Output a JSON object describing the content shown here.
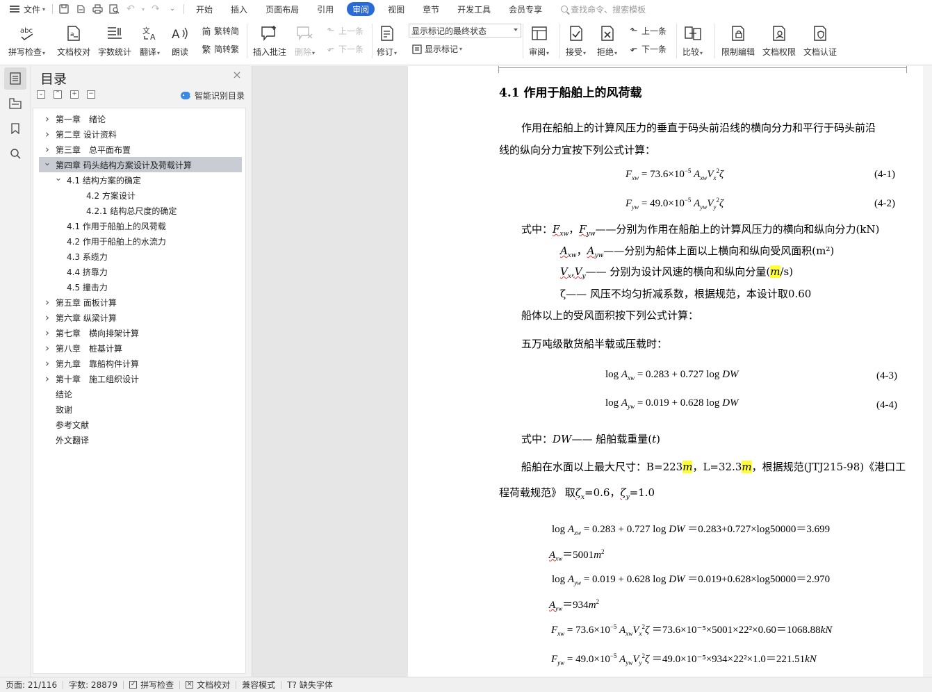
{
  "menubar": {
    "file_label": "文件",
    "tabs": [
      "开始",
      "插入",
      "页面布局",
      "引用",
      "审阅",
      "视图",
      "章节",
      "开发工具",
      "会员专享"
    ],
    "active_tab": "审阅",
    "search_placeholder": "查找命令、搜索模板"
  },
  "ribbon": {
    "spell_check": "拼写检查",
    "doc_proof": "文档校对",
    "word_count": "字数统计",
    "translate": "翻译",
    "read_aloud": "朗读",
    "to_traditional": "繁转简",
    "to_simplified": "简转繁",
    "insert_comment": "插入批注",
    "delete": "删除",
    "prev_comment": "上一条",
    "next_comment": "下一条",
    "track_changes": "修订",
    "markup_mode": "显示标记的最终状态",
    "show_markup": "显示标记",
    "review_pane": "审阅",
    "accept": "接受",
    "reject": "拒绝",
    "prev_change": "上一条",
    "next_change": "下一条",
    "compare": "比较",
    "restrict_edit": "限制编辑",
    "doc_permission": "文档权限",
    "doc_cert": "文档认证"
  },
  "toc": {
    "title": "目录",
    "smart_label": "智能识别目录",
    "items": [
      {
        "label": "第一章　绪论",
        "level": 0,
        "expand": "right"
      },
      {
        "label": "第二章  设计资料",
        "level": 0,
        "expand": "right"
      },
      {
        "label": "第三章　总平面布置",
        "level": 0,
        "expand": "right"
      },
      {
        "label": "第四章  码头结构方案设计及荷载计算",
        "level": 0,
        "expand": "down",
        "selected": true
      },
      {
        "label": "4.1  结构方案的确定",
        "level": 1,
        "expand": "down"
      },
      {
        "label": "4.2 方案设计",
        "level": 2
      },
      {
        "label": "4.2.1 结构总尺度的确定",
        "level": 2
      },
      {
        "label": "4.1 作用于船舶上的风荷载",
        "level": 1
      },
      {
        "label": "4.2 作用于船舶上的水流力",
        "level": 1
      },
      {
        "label": "4.3 系缆力",
        "level": 1
      },
      {
        "label": "4.4 挤靠力",
        "level": 1
      },
      {
        "label": "4.5 撞击力",
        "level": 1
      },
      {
        "label": "第五章  面板计算",
        "level": 0,
        "expand": "right"
      },
      {
        "label": "第六章  纵梁计算",
        "level": 0,
        "expand": "right"
      },
      {
        "label": "第七章　横向排架计算",
        "level": 0,
        "expand": "right"
      },
      {
        "label": "第八章　桩基计算",
        "level": 0,
        "expand": "right"
      },
      {
        "label": "第九章　靠船构件计算",
        "level": 0,
        "expand": "right"
      },
      {
        "label": "第十章　施工组织设计",
        "level": 0,
        "expand": "right"
      },
      {
        "label": "结论",
        "level": 0
      },
      {
        "label": "致谢",
        "level": 0
      },
      {
        "label": "参考文献",
        "level": 0
      },
      {
        "label": "外文翻译",
        "level": 0
      }
    ]
  },
  "doc": {
    "heading": "4.1 作用于船舶上的风荷载",
    "para1a": "作用在船舶上的计算风压力的垂直于码头前沿线的横向分力和平行于码头前沿",
    "para1b": "线的纵向分力宜按下列公式计算：",
    "eqno1": "(4-1)",
    "eqno2": "(4-2)",
    "where1_prefix": "式中：",
    "where1_text": "——分别为作用在船舶上的计算风压力的横向和纵向分力(kN)",
    "where2_text": "——分别为船体上面以上横向和纵向受风面积(m²)",
    "where3_text": "——  分别为设计风速的横向和纵向分量(",
    "where3_unit_m": "m",
    "where3_unit_rest": "/s)",
    "where4_text": "ζ——  风压不均匀折减系数，根据规范，本设计取0.60",
    "para2": "船体以上的受风面积按下列公式计算：",
    "para3": "五万吨级散货船半载或压载时：",
    "eqno3": "(4-3)",
    "eqno4": "(4-4)",
    "where5_prefix": "式中：",
    "where5_text": "——  船舶载重量(",
    "where5_unit": "t",
    "para4a_1": "船舶在水面以上最大尺寸：B=223",
    "para4a_m1": "m",
    "para4a_2": "，L=32.3",
    "para4a_m2": "m",
    "para4a_3": "，根据规范(JTJ215-98)《港口工",
    "para4b": "程荷载规范》 取",
    "calc1_rhs": "＝0.283+0.727×log50000＝3.699",
    "calc2_rhs": "＝5001",
    "calc3_rhs": "＝0.019+0.628×log50000＝2.970",
    "calc4_rhs": "＝934",
    "calc5_rhs": "＝73.6×10⁻⁵×5001×22²×0.60＝1068.88",
    "calc6_rhs": "＝49.0×10⁻⁵×934×22²×1.0＝221.51"
  },
  "status": {
    "page": "页面: 21/116",
    "words": "字数: 28879",
    "spell": "拼写检查",
    "proof": "文档校对",
    "compat": "兼容模式",
    "missing_font": "缺失字体"
  },
  "colors": {
    "accent": "#2a6ad6",
    "highlight": "#ffff33",
    "toc_selected": "#c9cdd3"
  }
}
